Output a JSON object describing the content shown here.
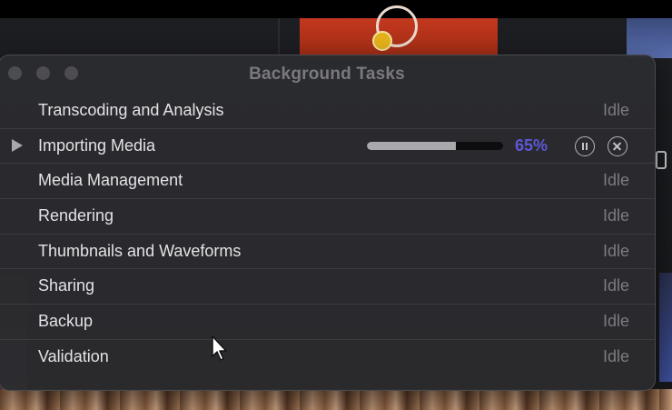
{
  "window": {
    "title": "Background Tasks"
  },
  "tasks": [
    {
      "name": "Transcoding and Analysis",
      "status": "Idle"
    },
    {
      "name": "Importing Media",
      "percent": "65%",
      "progress": 0.65
    },
    {
      "name": "Media Management",
      "status": "Idle"
    },
    {
      "name": "Rendering",
      "status": "Idle"
    },
    {
      "name": "Thumbnails and Waveforms",
      "status": "Idle"
    },
    {
      "name": "Sharing",
      "status": "Idle"
    },
    {
      "name": "Backup",
      "status": "Idle"
    },
    {
      "name": "Validation",
      "status": "Idle"
    }
  ],
  "colors": {
    "accent": "#5e57d6",
    "panel": "#2b2b2e",
    "idle_text": "#7c7c80"
  },
  "icons": {
    "disclosure": "disclosure-triangle-icon",
    "pause": "pause-circle-icon",
    "cancel": "cancel-circle-icon",
    "cursor": "mouse-pointer-icon"
  }
}
